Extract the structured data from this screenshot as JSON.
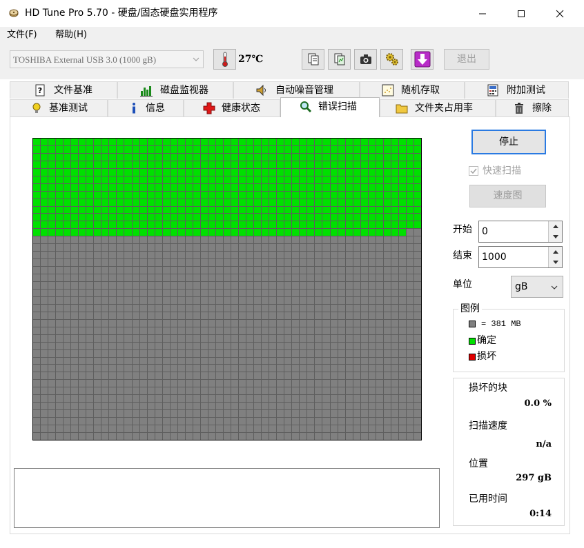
{
  "window": {
    "title": "HD Tune Pro 5.70 - 硬盘/固态硬盘实用程序"
  },
  "menu": {
    "file": "文件(F)",
    "help": "帮助(H)"
  },
  "toolbar": {
    "drive": "TOSHIBA External USB 3.0 (1000 gB)",
    "temperature": "27℃",
    "exit": "退出"
  },
  "tabs": {
    "row1": [
      "文件基准",
      "磁盘监视器",
      "自动噪音管理",
      "随机存取",
      "附加测试"
    ],
    "row2": [
      "基准测试",
      "信息",
      "健康状态",
      "错误扫描",
      "文件夹占用率",
      "擦除"
    ],
    "active": "错误扫描"
  },
  "scan": {
    "grid_columns": 51,
    "grid_rows": 40,
    "scanned_blocks": 661,
    "stop": "停止",
    "quick_scan": "快速扫描",
    "quick_scan_checked": true,
    "speed_map": "速度图",
    "start_label": "开始",
    "start_value": "0",
    "end_label": "结束",
    "end_value": "1000",
    "unit_label": "单位",
    "unit_value": "gB"
  },
  "legend": {
    "title": "图例",
    "block_size": "= 381 MB",
    "ok": "确定",
    "damaged": "损坏",
    "colors": {
      "block": "#808080",
      "ok": "#00e000",
      "damaged": "#e00000"
    }
  },
  "stats": {
    "damaged_blocks_label": "损坏的块",
    "damaged_blocks_value": "0.0 %",
    "scan_speed_label": "扫描速度",
    "scan_speed_value": "n/a",
    "position_label": "位置",
    "position_value": "297 gB",
    "elapsed_label": "已用时间",
    "elapsed_value": "0:14"
  }
}
